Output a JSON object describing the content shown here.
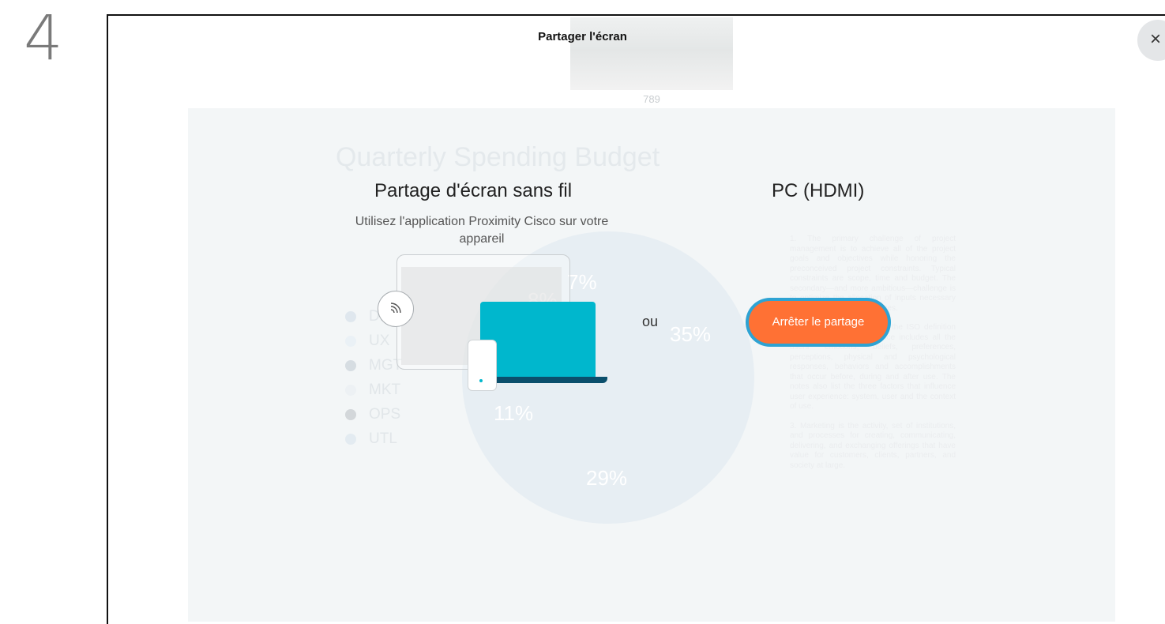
{
  "step": {
    "number": "4"
  },
  "header": {
    "title": "Partager l'écran",
    "thumbnail_caption": "789"
  },
  "close": {
    "glyph": "×"
  },
  "background_slide": {
    "title": "Quarterly Spending Budget",
    "legend": [
      {
        "label": "DES",
        "color": "#dfe7ee"
      },
      {
        "label": "UX",
        "color": "#eaf1f6"
      },
      {
        "label": "MGT",
        "color": "#d6dde2"
      },
      {
        "label": "MKT",
        "color": "#edf1f4"
      },
      {
        "label": "OPS",
        "color": "#d3d7da"
      },
      {
        "label": "UTL",
        "color": "#e3ebf1"
      }
    ],
    "pie_labels": [
      "7%",
      "8%",
      "35%",
      "11%",
      "29%"
    ],
    "doc_paragraphs": [
      "1. The primary challenge of project management is to achieve all of the project goals and objectives while honoring the preconceived project constraints. Typical constraints are scope, time and budget. The secondary—and more ambitious—challenge is to optimize the allocation of inputs necessary to meet pre-defined objectives.",
      "2. The additional notes for the ISO definition explain that user experience includes all the users' emotions, beliefs, preferences, perceptions, physical and psychological responses, behaviors and accomplishments that occur before, during and after use. The notes also list the three factors that influence user experience: system, user and the context of use.",
      "3. Marketing is the activity, set of institutions, and processes for creating, communicating, delivering, and exchanging offerings that have value for customers, clients, partners, and society at large."
    ]
  },
  "wireless": {
    "title": "Partage d'écran sans fil",
    "subtitle": "Utilisez l'application Proximity Cisco sur votre appareil"
  },
  "separator": "ou",
  "pc": {
    "title": "PC (HDMI)",
    "stop_button": "Arrêter le partage"
  }
}
